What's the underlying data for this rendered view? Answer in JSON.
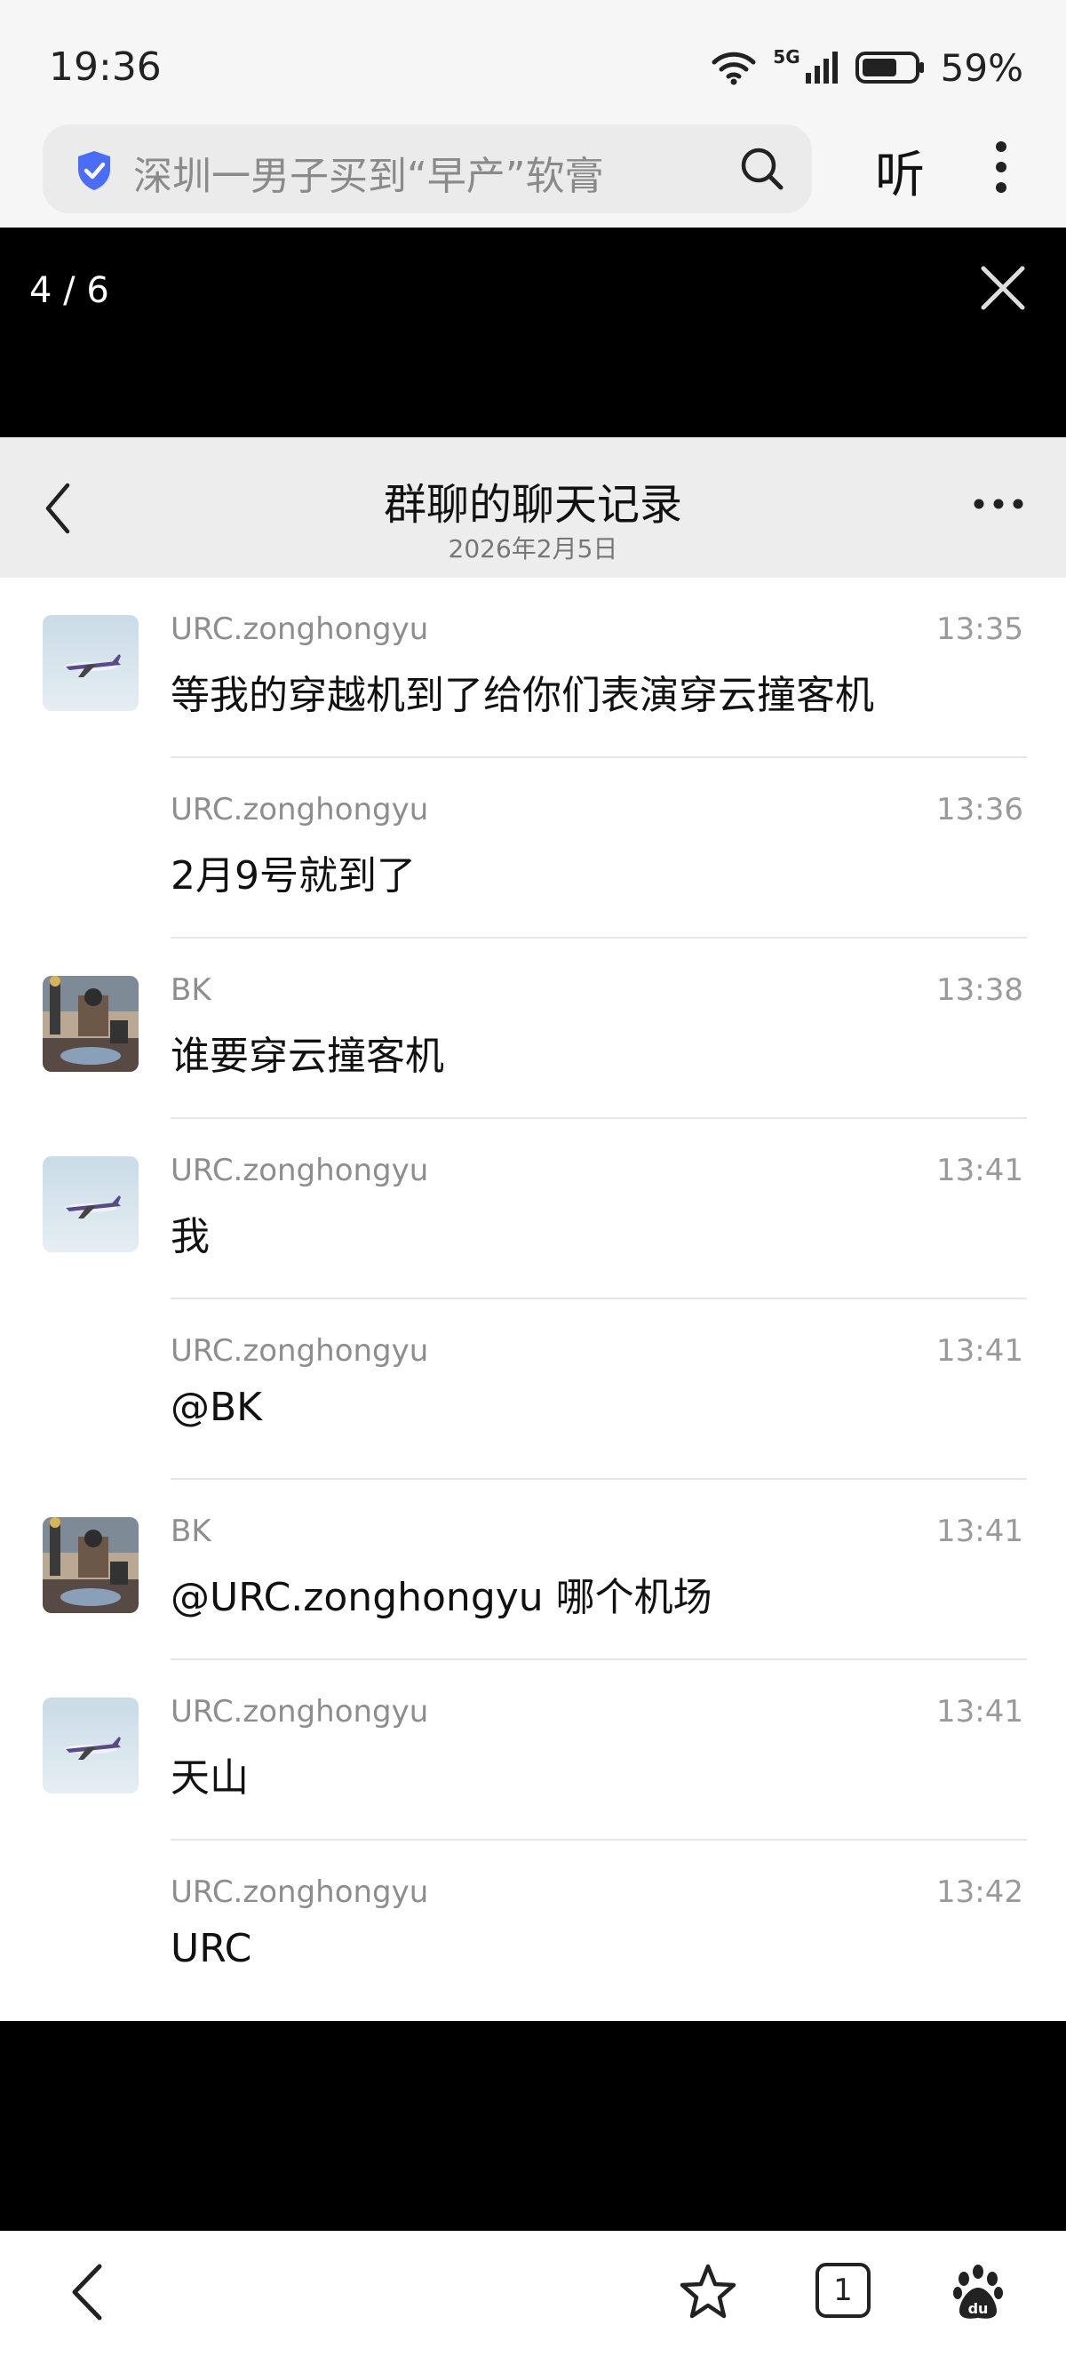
{
  "status": {
    "time": "19:36",
    "network": "5G",
    "battery": "59%"
  },
  "search": {
    "query": "深圳一男子买到“早产”软膏",
    "listen_label": "听"
  },
  "viewer": {
    "counter": "4 / 6"
  },
  "chat": {
    "title": "群聊的聊天记录",
    "date": "2026年2月5日",
    "messages": [
      {
        "sender": "URC.zonghongyu",
        "time": "13:35",
        "text": "等我的穿越机到了给你们表演穿云撞客机",
        "avatar": "plane-avatar"
      },
      {
        "sender": "URC.zonghongyu",
        "time": "13:36",
        "text": "2月9号就到了",
        "avatar": ""
      },
      {
        "sender": "BK",
        "time": "13:38",
        "text": "谁要穿云撞客机",
        "avatar": "street-avatar"
      },
      {
        "sender": "URC.zonghongyu",
        "time": "13:41",
        "text": "我",
        "avatar": "plane-avatar"
      },
      {
        "sender": "URC.zonghongyu",
        "time": "13:41",
        "text": "@BK",
        "avatar": ""
      },
      {
        "sender": "BK",
        "time": "13:41",
        "text": "@URC.zonghongyu 哪个机场",
        "avatar": "street-avatar"
      },
      {
        "sender": "URC.zonghongyu",
        "time": "13:41",
        "text": "天山",
        "avatar": "plane-avatar"
      },
      {
        "sender": "URC.zonghongyu",
        "time": "13:42",
        "text": "URC",
        "avatar": ""
      }
    ]
  },
  "bottom": {
    "tabs_count": "1"
  },
  "colors": {
    "accent": "#4a6cf7",
    "viewer_bg": "#000000",
    "header_bg": "#ededed"
  }
}
